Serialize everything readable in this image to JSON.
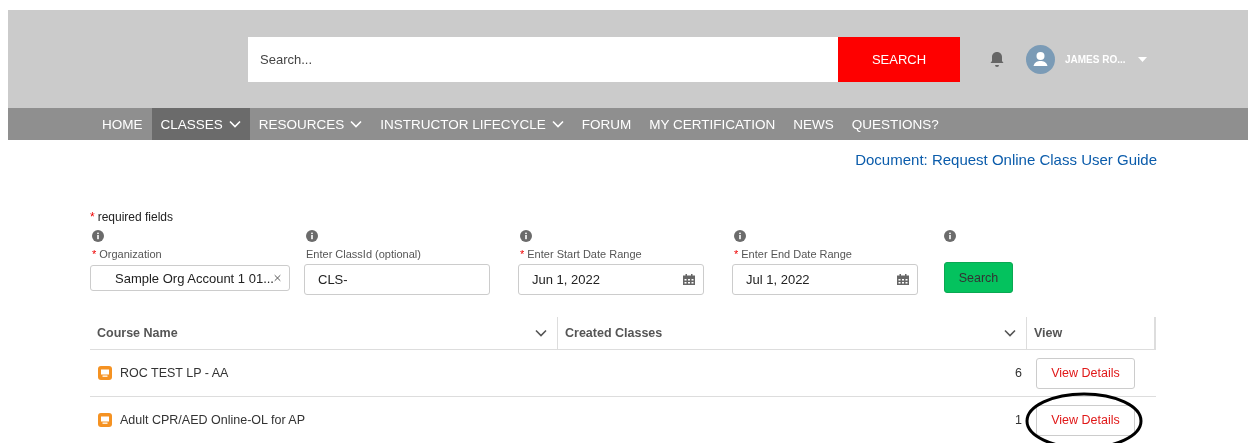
{
  "header": {
    "search": {
      "placeholder": "Search...",
      "button": "SEARCH"
    },
    "user": {
      "name": "JAMES RO..."
    }
  },
  "nav": [
    {
      "label": "HOME",
      "has_menu": false,
      "selected": false
    },
    {
      "label": "CLASSES",
      "has_menu": true,
      "selected": true
    },
    {
      "label": "RESOURCES",
      "has_menu": true,
      "selected": false
    },
    {
      "label": "INSTRUCTOR LIFECYCLE",
      "has_menu": true,
      "selected": false
    },
    {
      "label": "FORUM",
      "has_menu": false,
      "selected": false
    },
    {
      "label": "MY CERTIFICATION",
      "has_menu": false,
      "selected": false
    },
    {
      "label": "NEWS",
      "has_menu": false,
      "selected": false
    },
    {
      "label": "QUESTIONS?",
      "has_menu": false,
      "selected": false
    }
  ],
  "doc_link": "Document: Request Online Class User Guide",
  "required_note": {
    "mark": "*",
    "text": "required fields"
  },
  "filters": [
    {
      "kind": "lookup",
      "mark": "*",
      "label": "Organization",
      "value": "Sample Org Account 1 01..."
    },
    {
      "kind": "text",
      "label": "Enter ClassId (optional)",
      "value": "CLS-"
    },
    {
      "kind": "date",
      "mark": "*",
      "label": "Enter Start Date Range",
      "value": "Jun 1, 2022"
    },
    {
      "kind": "date",
      "mark": "*",
      "label": "Enter End Date Range",
      "value": "Jul 1, 2022"
    }
  ],
  "search_button": "Search",
  "table": {
    "columns": [
      {
        "label": "Course Name",
        "has_menu": true
      },
      {
        "label": "Created Classes",
        "has_menu": true
      },
      {
        "label": "View",
        "has_menu": false
      }
    ],
    "rows": [
      {
        "course": "ROC TEST LP - AA",
        "created": "6",
        "action": "View Details",
        "circled": false
      },
      {
        "course": "Adult CPR/AED Online-OL for AP",
        "created": "1",
        "action": "View Details",
        "circled": true
      }
    ]
  }
}
